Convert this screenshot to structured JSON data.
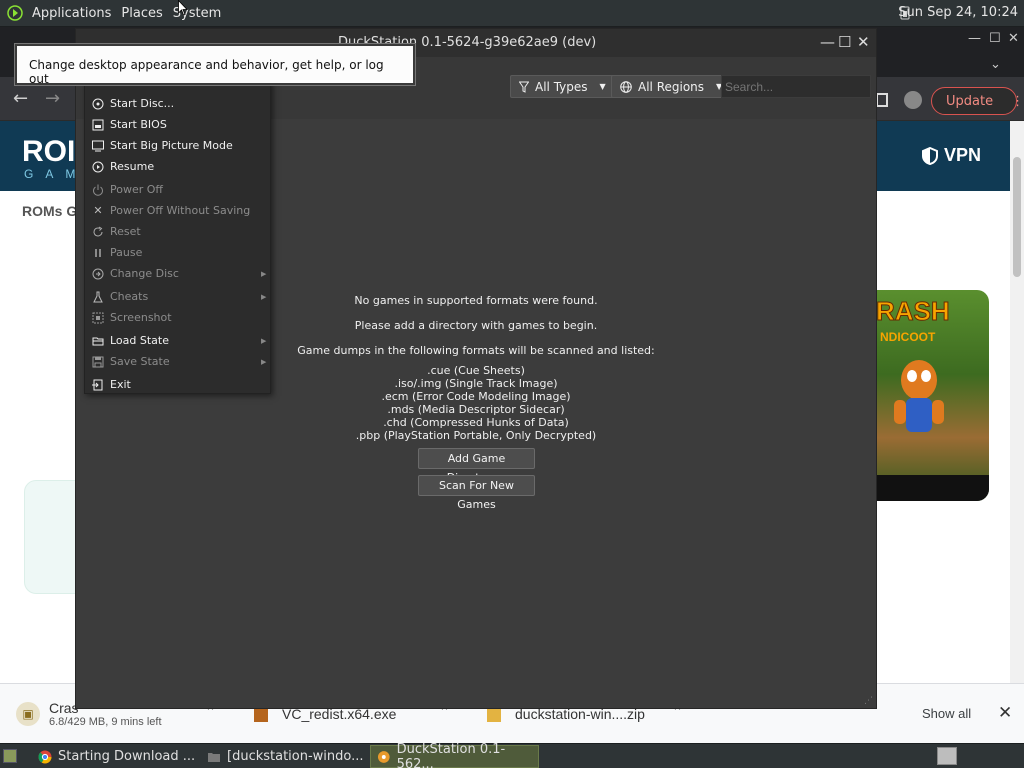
{
  "top_panel": {
    "menus": [
      "Applications",
      "Places",
      "System"
    ],
    "clock": "Sun Sep 24, 10:24"
  },
  "browser": {
    "site_logo_main": "ROI",
    "site_logo_sub": "GAM",
    "vpn_label": "VPN",
    "breadcrumb": "ROMs G",
    "update_label": "Update",
    "crash_title": "RASH",
    "crash_subtitle": "NDICOOT",
    "downloads": [
      {
        "name": "Cras",
        "meta": "6.8/429 MB, 9 mins left"
      },
      {
        "name": "VC_redist.x64.exe",
        "meta": ""
      },
      {
        "name": "duckstation-win....zip",
        "meta": ""
      }
    ],
    "show_all": "Show all"
  },
  "duckstation": {
    "title": "DuckStation 0.1-5624-g39e62ae9 (dev)",
    "filters": {
      "types": "All Types",
      "regions": "All Regions"
    },
    "search_placeholder": "Search...",
    "messages": {
      "no_games": "No games in supported formats were found.",
      "add_dir": "Please add a directory with games to begin.",
      "formats_intro": "Game dumps in the following formats will be scanned and listed:"
    },
    "formats": [
      ".cue (Cue Sheets)",
      ".iso/.img (Single Track Image)",
      ".ecm (Error Code Modeling Image)",
      ".mds (Media Descriptor Sidecar)",
      ".chd (Compressed Hunks of Data)",
      ".pbp (PlayStation Portable, Only Decrypted)"
    ],
    "buttons": {
      "add_dir": "Add Game Directory...",
      "scan": "Scan For New Games"
    }
  },
  "system_menu": {
    "items": [
      {
        "label": "Start Disc...",
        "icon": "disc-icon",
        "enabled": true,
        "submenu": false
      },
      {
        "label": "Start BIOS",
        "icon": "chip-icon",
        "enabled": true,
        "submenu": false
      },
      {
        "label": "Start Big Picture Mode",
        "icon": "monitor-icon",
        "enabled": true,
        "submenu": false
      },
      {
        "label": "Resume",
        "icon": "play-icon",
        "enabled": true,
        "submenu": false
      },
      {
        "label": "Power Off",
        "icon": "power-icon",
        "enabled": false,
        "submenu": false
      },
      {
        "label": "Power Off Without Saving",
        "icon": "close-icon",
        "enabled": false,
        "submenu": false
      },
      {
        "label": "Reset",
        "icon": "reset-icon",
        "enabled": false,
        "submenu": false
      },
      {
        "label": "Pause",
        "icon": "pause-icon",
        "enabled": false,
        "submenu": false
      },
      {
        "label": "Change Disc",
        "icon": "disc-swap-icon",
        "enabled": false,
        "submenu": true
      },
      {
        "label": "Cheats",
        "icon": "flask-icon",
        "enabled": false,
        "submenu": true
      },
      {
        "label": "Screenshot",
        "icon": "screenshot-icon",
        "enabled": false,
        "submenu": false
      },
      {
        "label": "Load State",
        "icon": "folder-open-icon",
        "enabled": true,
        "submenu": true
      },
      {
        "label": "Save State",
        "icon": "save-icon",
        "enabled": false,
        "submenu": true
      },
      {
        "label": "Exit",
        "icon": "exit-icon",
        "enabled": true,
        "submenu": false
      }
    ]
  },
  "tooltip": "Change desktop appearance and behavior, get help, or log out",
  "taskbar": {
    "tasks": [
      {
        "label": "Starting Download ...",
        "icon": "chrome-icon"
      },
      {
        "label": "[duckstation-windo...",
        "icon": "folder-icon"
      },
      {
        "label": "DuckStation 0.1-562...",
        "icon": "duckstation-icon"
      }
    ]
  }
}
